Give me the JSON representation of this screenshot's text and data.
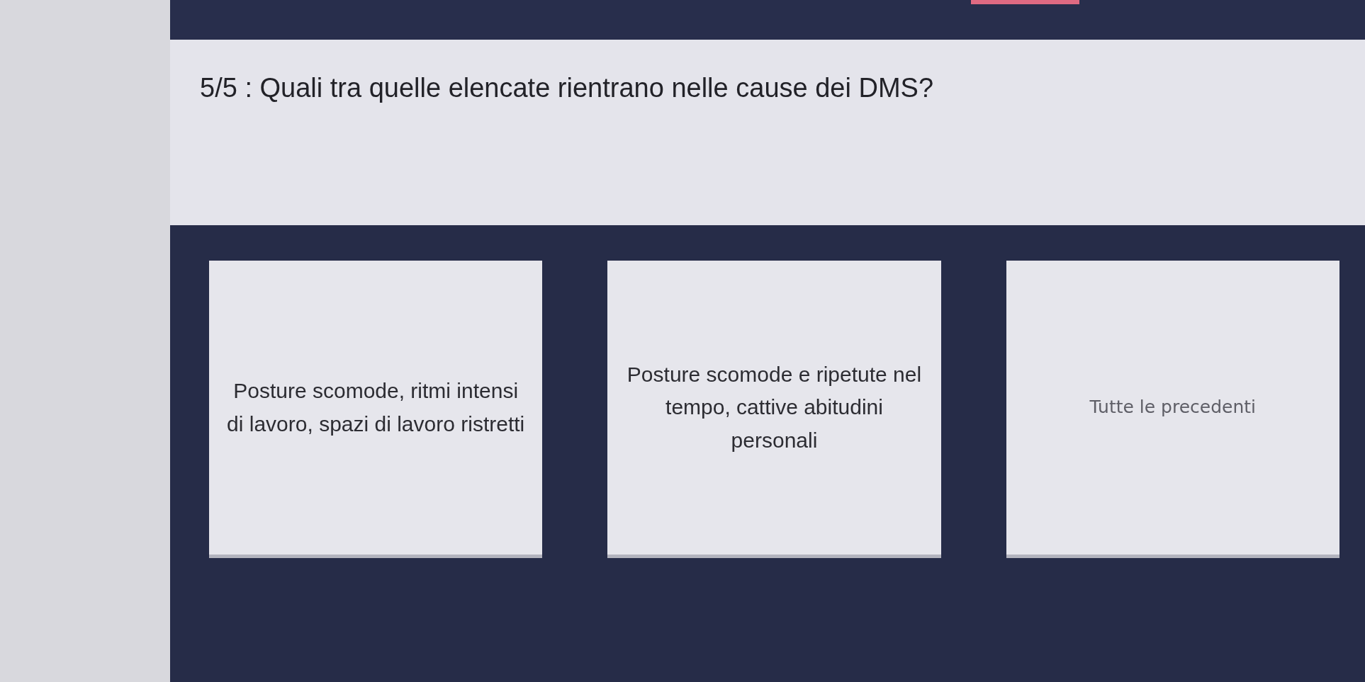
{
  "question": {
    "text": "5/5 : Quali tra quelle elencate rientrano nelle cause dei DMS?"
  },
  "answers": [
    {
      "kind": "regular",
      "text": "Posture scomode, ritmi intensi\ndi lavoro, spazi di lavoro ristretti"
    },
    {
      "kind": "regular",
      "text": "Posture scomode e ripetute nel\ntempo, cattive abitudini\npersonali"
    },
    {
      "kind": "faded",
      "text": "Tutte le precedenti"
    }
  ]
}
